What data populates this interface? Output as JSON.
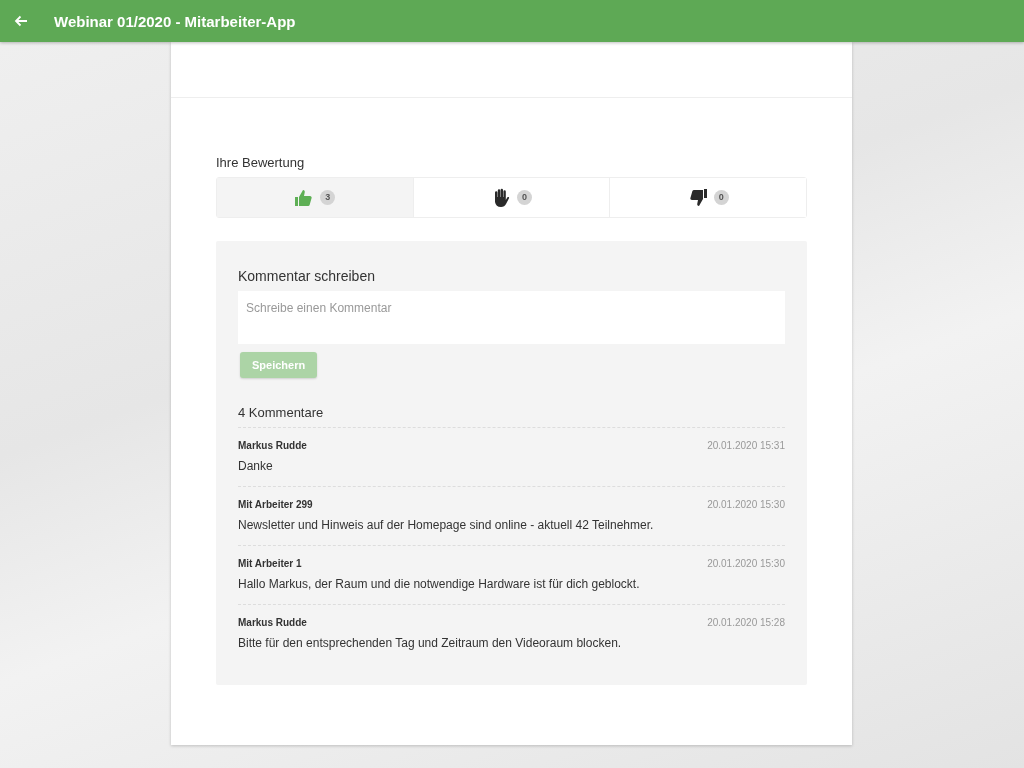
{
  "header": {
    "title": "Webinar 01/2020 - Mitarbeiter-App"
  },
  "rating": {
    "label": "Ihre Bewertung",
    "options": [
      {
        "kind": "like",
        "count": "3",
        "selected": true
      },
      {
        "kind": "neutral",
        "count": "0",
        "selected": false
      },
      {
        "kind": "dislike",
        "count": "0",
        "selected": false
      }
    ]
  },
  "comment_form": {
    "title": "Kommentar schreiben",
    "placeholder": "Schreibe einen Kommentar",
    "button": {
      "label": "Speichern",
      "disabled": true
    }
  },
  "comments": {
    "count_label": "4 Kommentare",
    "items": [
      {
        "author": "Markus Rudde",
        "time": "20.01.2020 15:31",
        "text": "Danke"
      },
      {
        "author": "Mit Arbeiter 299",
        "time": "20.01.2020 15:30",
        "text": "Newsletter und Hinweis auf der Homepage sind online - aktuell 42 Teilnehmer."
      },
      {
        "author": "Mit Arbeiter 1",
        "time": "20.01.2020 15:30",
        "text": "Hallo Markus, der Raum und die notwendige Hardware ist für dich geblockt."
      },
      {
        "author": "Markus Rudde",
        "time": "20.01.2020 15:28",
        "text": "Bitte für den entsprechenden Tag und Zeitraum den Videoraum blocken."
      }
    ]
  }
}
